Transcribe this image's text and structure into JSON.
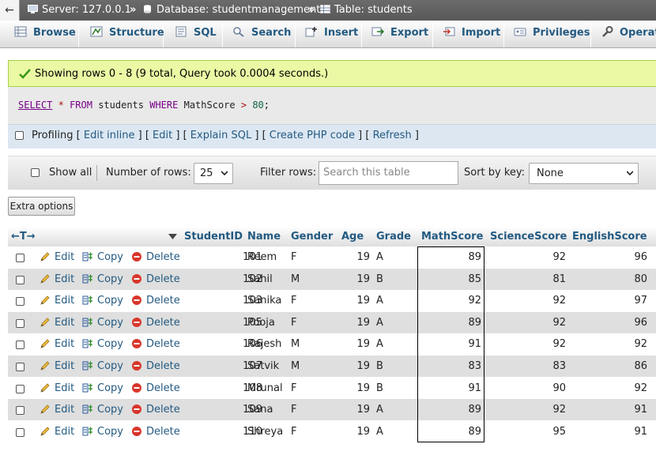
{
  "breadcrumb": {
    "back": "←",
    "server": "Server: 127.0.0.1",
    "database": "Database: studentmanagement",
    "table": "Table: students",
    "separator": "»"
  },
  "tabs": [
    {
      "label": "Browse",
      "icon": "browse-icon"
    },
    {
      "label": "Structure",
      "icon": "structure-icon"
    },
    {
      "label": "SQL",
      "icon": "sql-icon"
    },
    {
      "label": "Search",
      "icon": "search-icon"
    },
    {
      "label": "Insert",
      "icon": "insert-icon"
    },
    {
      "label": "Export",
      "icon": "export-icon"
    },
    {
      "label": "Import",
      "icon": "import-icon"
    },
    {
      "label": "Privileges",
      "icon": "privileges-icon"
    },
    {
      "label": "Operati",
      "icon": "operations-icon"
    }
  ],
  "success_message": "Showing rows 0 - 8 (9 total, Query took 0.0004 seconds.)",
  "sql": {
    "select": "SELECT",
    "star": "*",
    "from": "FROM",
    "table": "students",
    "where": "WHERE",
    "column": "MathScore",
    "op": ">",
    "value": "80",
    "end": ";"
  },
  "profiling": {
    "label": "Profiling",
    "links": [
      "Edit inline",
      "Edit",
      "Explain SQL",
      "Create PHP code",
      "Refresh"
    ]
  },
  "filters": {
    "show_all": "Show all",
    "number_of_rows_label": "Number of rows:",
    "number_of_rows": "25",
    "filter_rows_label": "Filter rows:",
    "filter_placeholder": "Search this table",
    "sort_by_label": "Sort by key:",
    "sort_by_value": "None"
  },
  "extra_options": "Extra options",
  "table": {
    "nav_arrows": "←T→",
    "columns": [
      "StudentID",
      "Name",
      "Gender",
      "Age",
      "Grade",
      "MathScore",
      "ScienceScore",
      "EnglishScore"
    ],
    "action_labels": {
      "edit": "Edit",
      "copy": "Copy",
      "delete": "Delete"
    },
    "rows": [
      [
        "101",
        "Reem",
        "F",
        "19",
        "A",
        "89",
        "92",
        "96"
      ],
      [
        "102",
        "Sahil",
        "M",
        "19",
        "B",
        "85",
        "81",
        "80"
      ],
      [
        "103",
        "Sanika",
        "F",
        "19",
        "A",
        "92",
        "92",
        "97"
      ],
      [
        "105",
        "Pooja",
        "F",
        "19",
        "A",
        "89",
        "92",
        "96"
      ],
      [
        "106",
        "Rajesh",
        "M",
        "19",
        "A",
        "91",
        "92",
        "92"
      ],
      [
        "107",
        "Satvik",
        "M",
        "19",
        "B",
        "83",
        "83",
        "86"
      ],
      [
        "108",
        "Mrunal",
        "F",
        "19",
        "B",
        "91",
        "90",
        "92"
      ],
      [
        "109",
        "Sana",
        "F",
        "19",
        "A",
        "89",
        "92",
        "91"
      ],
      [
        "110",
        "Shreya",
        "F",
        "19",
        "A",
        "89",
        "95",
        "91"
      ]
    ]
  },
  "colors": {
    "link": "#235a81",
    "success_bg": "#ebf8a4",
    "row_alt": "#dfdfdf"
  }
}
